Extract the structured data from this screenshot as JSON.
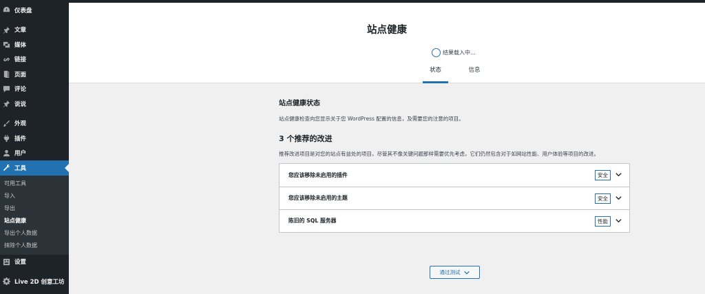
{
  "sidebar": {
    "items": [
      {
        "label": "仪表盘",
        "icon": "dashboard-icon"
      },
      {
        "label": "文章",
        "icon": "pin-icon"
      },
      {
        "label": "媒体",
        "icon": "media-icon"
      },
      {
        "label": "链接",
        "icon": "link-icon"
      },
      {
        "label": "页面",
        "icon": "page-icon"
      },
      {
        "label": "评论",
        "icon": "comment-icon"
      },
      {
        "label": "说说",
        "icon": "pin-icon"
      },
      {
        "label": "外观",
        "icon": "brush-icon"
      },
      {
        "label": "插件",
        "icon": "plugin-icon"
      },
      {
        "label": "用户",
        "icon": "user-icon"
      },
      {
        "label": "工具",
        "icon": "wrench-icon"
      },
      {
        "label": "设置",
        "icon": "settings-icon"
      },
      {
        "label": "Live 2D 创意工坊",
        "icon": "gear-icon"
      }
    ],
    "submenu": [
      {
        "label": "可用工具"
      },
      {
        "label": "导入"
      },
      {
        "label": "导出"
      },
      {
        "label": "站点健康"
      },
      {
        "label": "导出个人数据"
      },
      {
        "label": "抹除个人数据"
      }
    ]
  },
  "header": {
    "title": "站点健康",
    "progress_text": "结果载入中…",
    "tabs": [
      {
        "label": "状态"
      },
      {
        "label": "信息"
      }
    ]
  },
  "main": {
    "section_title": "站点健康状态",
    "section_desc": "站点健康检查向您显示关于您 WordPress 配置的信息，及需要您的注意的项目。",
    "count_heading": "3 个推荐的改进",
    "count_desc": "推荐改进项目是对您的站点有益处的项目，尽管其不像关键问题那样需要优先考虑，它们仍然包含对于如网站性能、用户体验等项目的改进。",
    "issues": [
      {
        "label": "您应该移除未启用的插件",
        "badge": "安全"
      },
      {
        "label": "您应该移除未启用的主题",
        "badge": "安全"
      },
      {
        "label": "陈旧的 SQL 服务器",
        "badge": "性能"
      }
    ],
    "passed_button": "通过测试"
  },
  "colors": {
    "accent": "#2271b1",
    "sidebar_bg": "#1d2327",
    "content_bg": "#f0f0f1"
  }
}
